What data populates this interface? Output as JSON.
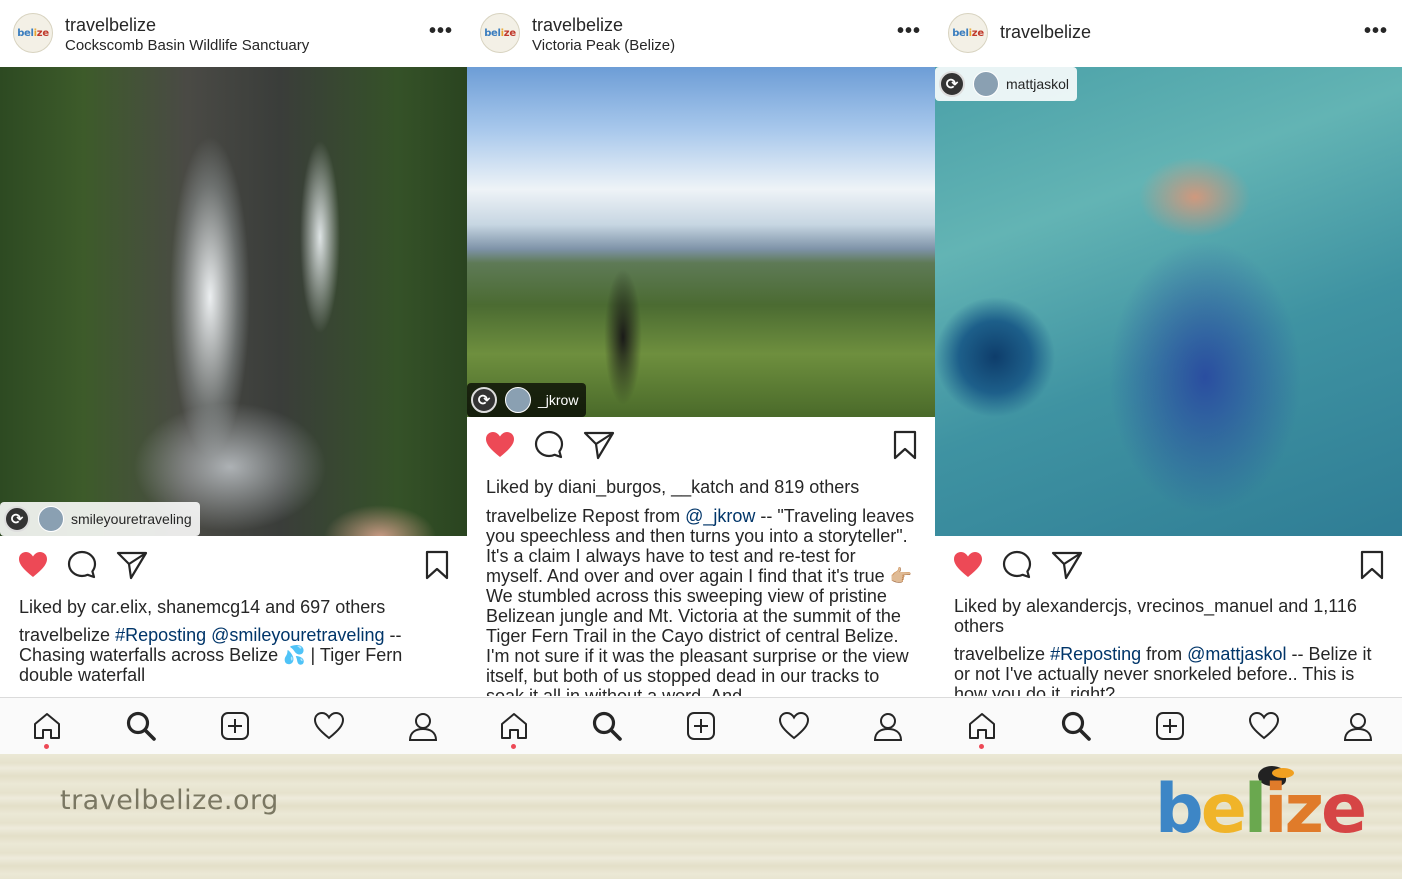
{
  "icons": {
    "heart": "heart-icon",
    "comment": "comment-icon",
    "share": "share-icon",
    "bookmark": "bookmark-icon",
    "more": "more-icon",
    "repost": "repost-icon",
    "nav": [
      "home-icon",
      "search-icon",
      "add-icon",
      "activity-icon",
      "profile-icon"
    ]
  },
  "colors": {
    "heart": "#ed4956",
    "link": "#003569",
    "text": "#262626"
  },
  "posts": [
    {
      "username": "travelbelize",
      "location": "Cockscomb Basin Wildlife Sanctuary",
      "more": "•••",
      "tag_user": "smileyouretraveling",
      "liked": true,
      "likes_prefix": "Liked by ",
      "likes_users": "car.elix, shanemcg14",
      "likes_suffix": " and 697 others",
      "caption_user": "travelbelize",
      "caption_link1": "#Reposting @smileyouretraveling",
      "caption_text": " -- Chasing waterfalls across Belize 💦 | Tiger Fern double waterfall"
    },
    {
      "username": "travelbelize",
      "location": "Victoria Peak (Belize)",
      "more": "•••",
      "tag_user": "_jkrow",
      "liked": true,
      "likes_prefix": "Liked by ",
      "likes_users": "diani_burgos, __katch",
      "likes_suffix": " and 819 others",
      "caption_user": "travelbelize",
      "caption_text1": " Repost from ",
      "caption_link1": "@_jkrow",
      "caption_text": " -- \"Traveling leaves you speechless and then turns you into a storyteller\". It's a claim I always have to test and re-test for myself. And over and over again I find that it's true 👉🏼 We stumbled across this sweeping view of pristine Belizean jungle and Mt. Victoria at the summit of the Tiger Fern Trail in the Cayo district of central Belize. I'm not sure if it was the pleasant surprise or the view itself, but both of us stopped dead in our tracks to soak it all in without a word. And"
    },
    {
      "username": "travelbelize",
      "more": "•••",
      "tag_user": "mattjaskol",
      "liked": true,
      "likes_prefix": "Liked by ",
      "likes_users": "alexandercjs, vrecinos_manuel",
      "likes_suffix": " and 1,116 others",
      "caption_user": "travelbelize",
      "caption_link1": "#Reposting",
      "caption_text1": " from ",
      "caption_link2": "@mattjaskol",
      "caption_text": " -- Belize it or not I've actually never snorkeled before.. This is how you do it, right?"
    }
  ],
  "footer": {
    "url": "travelbelize.org"
  },
  "logo_text": "belize"
}
